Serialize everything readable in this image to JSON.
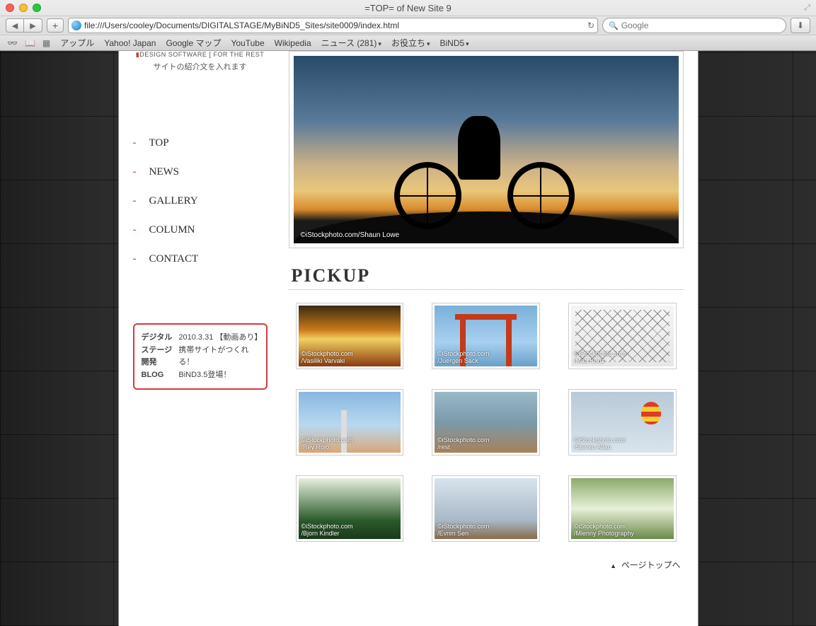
{
  "window": {
    "title": "=TOP= of New Site 9"
  },
  "toolbar": {
    "url": "file:///Users/cooley/Documents/DIGITALSTAGE/MyBiND5_Sites/site0009/index.html",
    "search_placeholder": "Google"
  },
  "bookmarks": {
    "items": [
      "アップル",
      "Yahoo! Japan",
      "Google マップ",
      "YouTube",
      "Wikipedia",
      "ニュース (281)",
      "お役立ち",
      "BiND5"
    ]
  },
  "sidebar": {
    "tagline": "DESIGN SOFTWARE [ FOR THE REST",
    "subtitle": "サイトの紹介文を入れます",
    "nav": [
      "TOP",
      "NEWS",
      "GALLERY",
      "COLUMN",
      "CONTACT"
    ],
    "blog": {
      "left": "デジタルステージ開発BLOG",
      "lines": [
        "2010.3.31 【動画あり】",
        "携帯サイトがつくれる！",
        "BiND3.5登場！"
      ]
    }
  },
  "main": {
    "hero_credit": "©iStockphoto.com/Shaun Lowe",
    "pickup_heading": "PICKUP",
    "page_top": "ページトップへ",
    "thumbs": [
      {
        "credit1": "©iStockphoto.com",
        "credit2": "/Vasiliki Varvaki",
        "bg": "linear-gradient(#3a2a10,#c97a1a 40%,#f0d060 55%,#8a3a10)"
      },
      {
        "credit1": "©iStockphoto.com",
        "credit2": "/Juergen Sack",
        "bg": "linear-gradient(#7ab0d8,#a8d0f0 60%,#6aa0c8)"
      },
      {
        "credit1": "©iStockphoto.com",
        "credit2": "/Matt Kunz",
        "bg": "linear-gradient(#f4f4f4,#e6e6e6)"
      },
      {
        "credit1": "©iStockphoto.com",
        "credit2": "/Rey Rojo",
        "bg": "linear-gradient(#88b8e0,#b8d8f0 55%,#d8a878)"
      },
      {
        "credit1": "©iStockphoto.com",
        "credit2": "/rest",
        "bg": "linear-gradient(#9ab9c8,#7a9aaa 50%,#a8825a)"
      },
      {
        "credit1": "©iStockphoto.com",
        "credit2": "/Steven Allan",
        "bg": "linear-gradient(#b8cad8,#d8e4ec)"
      },
      {
        "credit1": "©iStockphoto.com",
        "credit2": "/Bjorn Kindler",
        "bg": "linear-gradient(#e8f0e0,#2a5a2a 70%,#1a3a1a)"
      },
      {
        "credit1": "©iStockphoto.com",
        "credit2": "/Evrim Sen",
        "bg": "linear-gradient(#d8e4ec,#a8b8c8 70%,#886a4a)"
      },
      {
        "credit1": "©iStockphoto.com",
        "credit2": "/Mlenny Photography",
        "bg": "linear-gradient(#8aaa6a,#e8f0d8 50%,#6a8a4a)"
      }
    ]
  }
}
